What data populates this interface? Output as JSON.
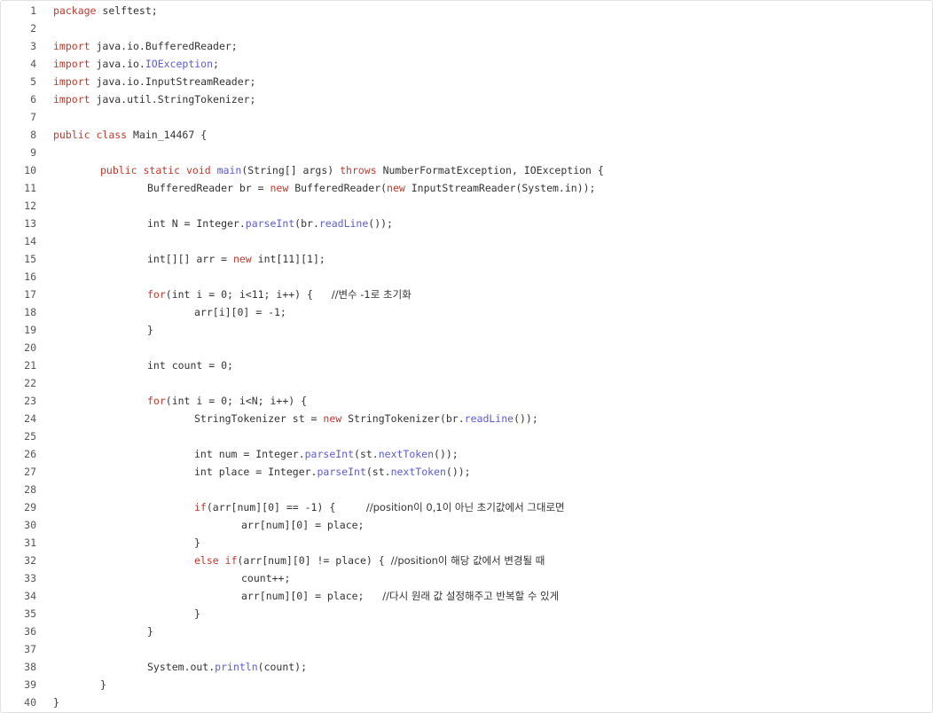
{
  "editor": {
    "colors": {
      "keyword": "#c0392b",
      "function": "#5b5bd6",
      "text": "#333333",
      "line_number": "#555555"
    },
    "lines": [
      {
        "n": "1",
        "indent": 0,
        "tokens": [
          {
            "t": "kw",
            "v": "package"
          },
          {
            "t": "tx",
            "v": " selftest;"
          }
        ]
      },
      {
        "n": "2",
        "indent": 0,
        "tokens": []
      },
      {
        "n": "3",
        "indent": 0,
        "tokens": [
          {
            "t": "kw",
            "v": "import"
          },
          {
            "t": "tx",
            "v": " java.io.BufferedReader;"
          }
        ]
      },
      {
        "n": "4",
        "indent": 0,
        "tokens": [
          {
            "t": "kw",
            "v": "import"
          },
          {
            "t": "tx",
            "v": " java.io."
          },
          {
            "t": "fn",
            "v": "IOException"
          },
          {
            "t": "tx",
            "v": ";"
          }
        ]
      },
      {
        "n": "5",
        "indent": 0,
        "tokens": [
          {
            "t": "kw",
            "v": "import"
          },
          {
            "t": "tx",
            "v": " java.io.InputStreamReader;"
          }
        ]
      },
      {
        "n": "6",
        "indent": 0,
        "tokens": [
          {
            "t": "kw",
            "v": "import"
          },
          {
            "t": "tx",
            "v": " java.util.StringTokenizer;"
          }
        ]
      },
      {
        "n": "7",
        "indent": 0,
        "tokens": []
      },
      {
        "n": "8",
        "indent": 0,
        "tokens": [
          {
            "t": "kw",
            "v": "public"
          },
          {
            "t": "tx",
            "v": " "
          },
          {
            "t": "kw",
            "v": "class"
          },
          {
            "t": "tx",
            "v": " Main_14467 {"
          }
        ]
      },
      {
        "n": "9",
        "indent": 0,
        "tokens": []
      },
      {
        "n": "10",
        "indent": 1,
        "tokens": [
          {
            "t": "kw",
            "v": "public"
          },
          {
            "t": "tx",
            "v": " "
          },
          {
            "t": "kw",
            "v": "static"
          },
          {
            "t": "tx",
            "v": " "
          },
          {
            "t": "kw",
            "v": "void"
          },
          {
            "t": "tx",
            "v": " "
          },
          {
            "t": "fn",
            "v": "main"
          },
          {
            "t": "tx",
            "v": "(String[] args) "
          },
          {
            "t": "kw",
            "v": "throws"
          },
          {
            "t": "tx",
            "v": " NumberFormatException, IOException {"
          }
        ]
      },
      {
        "n": "11",
        "indent": 2,
        "tokens": [
          {
            "t": "tx",
            "v": "BufferedReader br = "
          },
          {
            "t": "kw",
            "v": "new"
          },
          {
            "t": "tx",
            "v": " BufferedReader("
          },
          {
            "t": "kw",
            "v": "new"
          },
          {
            "t": "tx",
            "v": " InputStreamReader(System.in));"
          }
        ]
      },
      {
        "n": "12",
        "indent": 0,
        "tokens": []
      },
      {
        "n": "13",
        "indent": 2,
        "tokens": [
          {
            "t": "tx",
            "v": "int N = Integer."
          },
          {
            "t": "fn",
            "v": "parseInt"
          },
          {
            "t": "tx",
            "v": "(br."
          },
          {
            "t": "fn",
            "v": "readLine"
          },
          {
            "t": "tx",
            "v": "());"
          }
        ]
      },
      {
        "n": "14",
        "indent": 0,
        "tokens": []
      },
      {
        "n": "15",
        "indent": 2,
        "tokens": [
          {
            "t": "tx",
            "v": "int[][] arr = "
          },
          {
            "t": "kw",
            "v": "new"
          },
          {
            "t": "tx",
            "v": " int[11][1];"
          }
        ]
      },
      {
        "n": "16",
        "indent": 0,
        "tokens": []
      },
      {
        "n": "17",
        "indent": 2,
        "tokens": [
          {
            "t": "kw",
            "v": "for"
          },
          {
            "t": "tx",
            "v": "(int i = 0; i<11; i++) {   "
          },
          {
            "t": "cm",
            "v": "//변수 -1로 초기화"
          }
        ]
      },
      {
        "n": "18",
        "indent": 3,
        "tokens": [
          {
            "t": "tx",
            "v": "arr[i][0] = -1;"
          }
        ]
      },
      {
        "n": "19",
        "indent": 2,
        "tokens": [
          {
            "t": "tx",
            "v": "}"
          }
        ]
      },
      {
        "n": "20",
        "indent": 0,
        "tokens": []
      },
      {
        "n": "21",
        "indent": 2,
        "tokens": [
          {
            "t": "tx",
            "v": "int count = 0;"
          }
        ]
      },
      {
        "n": "22",
        "indent": 0,
        "tokens": []
      },
      {
        "n": "23",
        "indent": 2,
        "tokens": [
          {
            "t": "kw",
            "v": "for"
          },
          {
            "t": "tx",
            "v": "(int i = 0; i<N; i++) {"
          }
        ]
      },
      {
        "n": "24",
        "indent": 3,
        "tokens": [
          {
            "t": "tx",
            "v": "StringTokenizer st = "
          },
          {
            "t": "kw",
            "v": "new"
          },
          {
            "t": "tx",
            "v": " StringTokenizer(br."
          },
          {
            "t": "fn",
            "v": "readLine"
          },
          {
            "t": "tx",
            "v": "());"
          }
        ]
      },
      {
        "n": "25",
        "indent": 0,
        "tokens": []
      },
      {
        "n": "26",
        "indent": 3,
        "tokens": [
          {
            "t": "tx",
            "v": "int num = Integer."
          },
          {
            "t": "fn",
            "v": "parseInt"
          },
          {
            "t": "tx",
            "v": "(st."
          },
          {
            "t": "fn",
            "v": "nextToken"
          },
          {
            "t": "tx",
            "v": "());"
          }
        ]
      },
      {
        "n": "27",
        "indent": 3,
        "tokens": [
          {
            "t": "tx",
            "v": "int place = Integer."
          },
          {
            "t": "fn",
            "v": "parseInt"
          },
          {
            "t": "tx",
            "v": "(st."
          },
          {
            "t": "fn",
            "v": "nextToken"
          },
          {
            "t": "tx",
            "v": "());"
          }
        ]
      },
      {
        "n": "28",
        "indent": 0,
        "tokens": []
      },
      {
        "n": "29",
        "indent": 3,
        "tokens": [
          {
            "t": "kw",
            "v": "if"
          },
          {
            "t": "tx",
            "v": "(arr[num][0] == -1) {     "
          },
          {
            "t": "cm",
            "v": "//position이 0,1이 아닌 초기값에서 그대로면"
          }
        ]
      },
      {
        "n": "30",
        "indent": 4,
        "tokens": [
          {
            "t": "tx",
            "v": "arr[num][0] = place;"
          }
        ]
      },
      {
        "n": "31",
        "indent": 3,
        "tokens": [
          {
            "t": "tx",
            "v": "}"
          }
        ]
      },
      {
        "n": "32",
        "indent": 3,
        "tokens": [
          {
            "t": "kw",
            "v": "else"
          },
          {
            "t": "tx",
            "v": " "
          },
          {
            "t": "kw",
            "v": "if"
          },
          {
            "t": "tx",
            "v": "(arr[num][0] != place) { "
          },
          {
            "t": "cm",
            "v": "//position이 해당 값에서 변경될 때"
          }
        ]
      },
      {
        "n": "33",
        "indent": 4,
        "tokens": [
          {
            "t": "tx",
            "v": "count++;"
          }
        ]
      },
      {
        "n": "34",
        "indent": 4,
        "tokens": [
          {
            "t": "tx",
            "v": "arr[num][0] = place;   "
          },
          {
            "t": "cm",
            "v": "//다시 원래 값 설정해주고 반복할 수 있게"
          }
        ]
      },
      {
        "n": "35",
        "indent": 3,
        "tokens": [
          {
            "t": "tx",
            "v": "}"
          }
        ]
      },
      {
        "n": "36",
        "indent": 2,
        "tokens": [
          {
            "t": "tx",
            "v": "}"
          }
        ]
      },
      {
        "n": "37",
        "indent": 0,
        "tokens": []
      },
      {
        "n": "38",
        "indent": 2,
        "tokens": [
          {
            "t": "tx",
            "v": "System.out."
          },
          {
            "t": "fn",
            "v": "println"
          },
          {
            "t": "tx",
            "v": "(count);"
          }
        ]
      },
      {
        "n": "39",
        "indent": 1,
        "tokens": [
          {
            "t": "tx",
            "v": "}"
          }
        ]
      },
      {
        "n": "40",
        "indent": 0,
        "tokens": [
          {
            "t": "tx",
            "v": "}"
          }
        ]
      }
    ]
  }
}
